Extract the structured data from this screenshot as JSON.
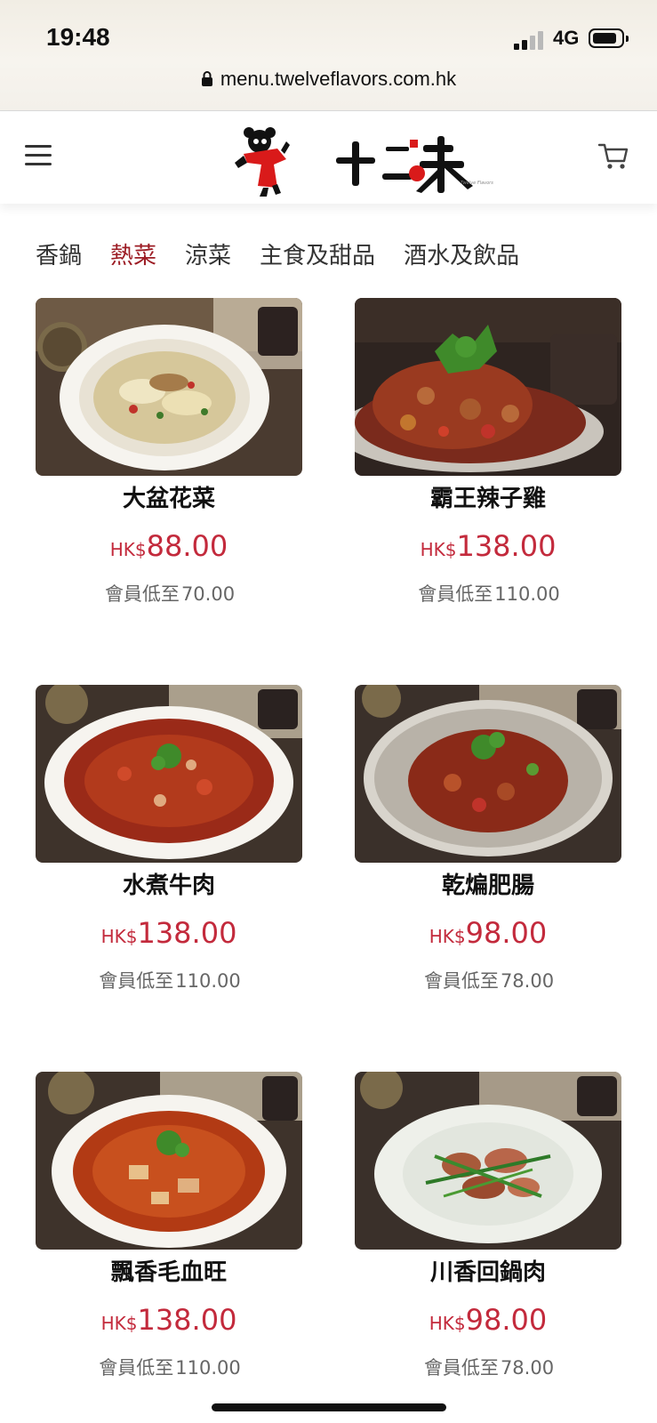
{
  "status_bar": {
    "time": "19:48",
    "network": "4G",
    "battery_level": 0.75
  },
  "browser": {
    "url": "menu.twelveflavors.com.hk"
  },
  "header": {
    "menu_icon": "hamburger-icon",
    "cart_icon": "cart-icon",
    "logo_text": "十二味"
  },
  "tabs": [
    {
      "label": "香鍋",
      "active": false
    },
    {
      "label": "熱菜",
      "active": true
    },
    {
      "label": "涼菜",
      "active": false
    },
    {
      "label": "主食及甜品",
      "active": false
    },
    {
      "label": "酒水及飲品",
      "active": false
    }
  ],
  "items": [
    {
      "name": "大盆花菜",
      "currency": "HK$",
      "price": "88.00",
      "member_label": "會員低至",
      "member_price": "70.00"
    },
    {
      "name": "霸王辣子雞",
      "currency": "HK$",
      "price": "138.00",
      "member_label": "會員低至",
      "member_price": "110.00"
    },
    {
      "name": "水煮牛肉",
      "currency": "HK$",
      "price": "138.00",
      "member_label": "會員低至",
      "member_price": "110.00"
    },
    {
      "name": "乾煸肥腸",
      "currency": "HK$",
      "price": "98.00",
      "member_label": "會員低至",
      "member_price": "78.00"
    },
    {
      "name": "飄香毛血旺",
      "currency": "HK$",
      "price": "138.00",
      "member_label": "會員低至",
      "member_price": "110.00"
    },
    {
      "name": "川香回鍋肉",
      "currency": "HK$",
      "price": "98.00",
      "member_label": "會員低至",
      "member_price": "78.00"
    }
  ],
  "colors": {
    "accent": "#9c1c24",
    "price": "#c32a3c",
    "member_text": "#666666"
  }
}
